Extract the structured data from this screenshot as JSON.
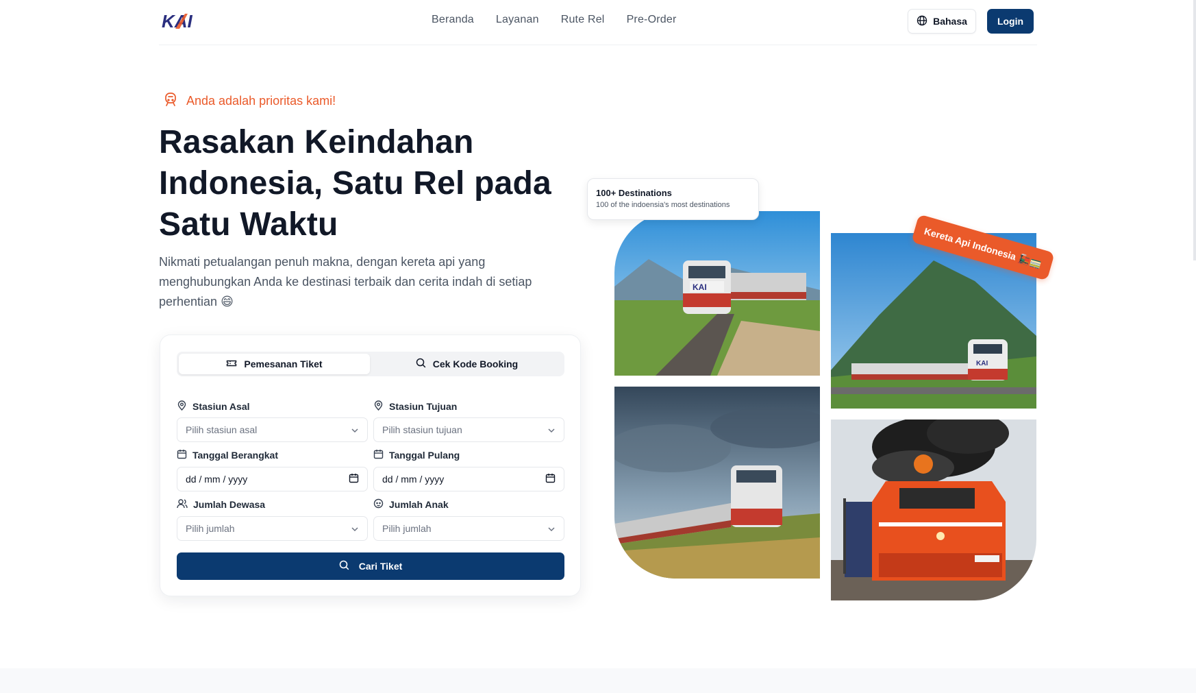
{
  "header": {
    "logo_text": "KAI",
    "nav": [
      "Beranda",
      "Layanan",
      "Rute Rel",
      "Pre-Order"
    ],
    "language_label": "Bahasa",
    "login_label": "Login"
  },
  "hero": {
    "tagline": "Anda adalah prioritas kami!",
    "title_line1": "Rasakan Keindahan",
    "title_line2": "Indonesia, Satu Rel pada",
    "title_line3": "Satu Waktu",
    "description": "Nikmati petualangan penuh makna, dengan kereta api yang menghubungkan Anda ke destinasi terbaik dan cerita indah di setiap perhentian 😄"
  },
  "booking": {
    "tab_active": "Pemesanan Tiket",
    "tab_inactive": "Cek Kode Booking",
    "origin_label": "Stasiun Asal",
    "origin_placeholder": "Pilih stasiun asal",
    "destination_label": "Stasiun Tujuan",
    "destination_placeholder": "Pilih stasiun tujuan",
    "depart_label": "Tanggal Berangkat",
    "depart_value": "dd / mm / yyyy",
    "return_label": "Tanggal Pulang",
    "return_value": "dd / mm / yyyy",
    "adult_label": "Jumlah Dewasa",
    "adult_placeholder": "Pilih jumlah",
    "child_label": "Jumlah Anak",
    "child_placeholder": "Pilih jumlah",
    "search_label": "Cari Tiket"
  },
  "gallery": {
    "destinations_title": "100+ Destinations",
    "destinations_sub": "100 of the indoensia's most destinations",
    "badge": "Kereta Api Indonesia 🚂🚃"
  },
  "colors": {
    "primary": "#0b3a70",
    "accent": "#ea5a2a",
    "text": "#111827"
  }
}
